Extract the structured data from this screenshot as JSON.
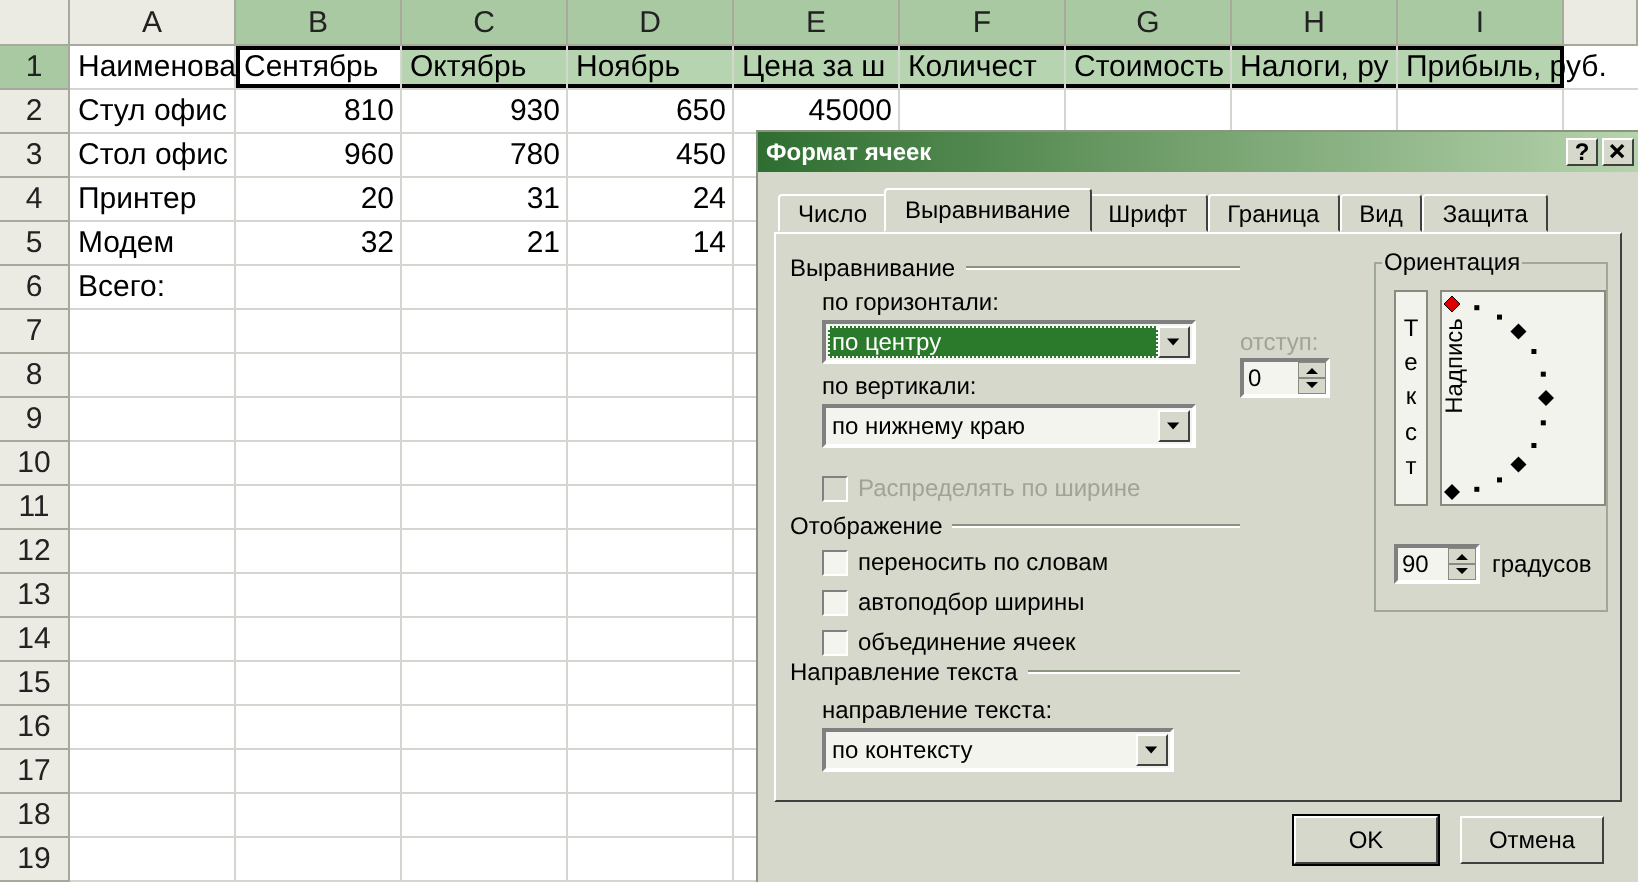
{
  "sheet": {
    "columns": [
      {
        "label": "A",
        "selected": false
      },
      {
        "label": "B",
        "selected": true
      },
      {
        "label": "C",
        "selected": true
      },
      {
        "label": "D",
        "selected": true
      },
      {
        "label": "E",
        "selected": true
      },
      {
        "label": "F",
        "selected": true
      },
      {
        "label": "G",
        "selected": true
      },
      {
        "label": "H",
        "selected": true
      },
      {
        "label": "I",
        "selected": true
      }
    ],
    "rows": [
      {
        "label": "1",
        "selected": true,
        "kind": "text",
        "cells": [
          "Наименова",
          "Сентябрь",
          "Октябрь",
          "Ноябрь",
          "Цена за ш",
          "Количест",
          "Стоимость",
          "Налоги, ру",
          "Прибыль, руб."
        ]
      },
      {
        "label": "2",
        "selected": false,
        "kind": "record",
        "cells": [
          "Стул офис",
          "810",
          "930",
          "650",
          "45000"
        ]
      },
      {
        "label": "3",
        "selected": false,
        "kind": "record",
        "cells": [
          "Стол офис",
          "960",
          "780",
          "450"
        ]
      },
      {
        "label": "4",
        "selected": false,
        "kind": "record",
        "cells": [
          "Принтер",
          "20",
          "31",
          "24"
        ]
      },
      {
        "label": "5",
        "selected": false,
        "kind": "record",
        "cells": [
          "Модем",
          "32",
          "21",
          "14"
        ]
      },
      {
        "label": "6",
        "selected": false,
        "kind": "text",
        "cells": [
          "Всего:"
        ]
      },
      {
        "label": "7",
        "selected": false
      },
      {
        "label": "8",
        "selected": false
      },
      {
        "label": "9",
        "selected": false
      },
      {
        "label": "10",
        "selected": false
      },
      {
        "label": "11",
        "selected": false
      },
      {
        "label": "12",
        "selected": false
      },
      {
        "label": "13",
        "selected": false
      },
      {
        "label": "14",
        "selected": false
      },
      {
        "label": "15",
        "selected": false
      },
      {
        "label": "16",
        "selected": false
      },
      {
        "label": "17",
        "selected": false
      },
      {
        "label": "18",
        "selected": false
      },
      {
        "label": "19",
        "selected": false
      }
    ]
  },
  "dialog": {
    "title": "Формат ячеек",
    "help_button": "?",
    "tabs": [
      {
        "label": "Число",
        "selected": false
      },
      {
        "label": "Выравнивание",
        "selected": true
      },
      {
        "label": "Шрифт",
        "selected": false
      },
      {
        "label": "Граница",
        "selected": false
      },
      {
        "label": "Вид",
        "selected": false
      },
      {
        "label": "Защита",
        "selected": false
      }
    ],
    "alignment": {
      "title": "Выравнивание",
      "horizontal": {
        "label": "по горизонтали:",
        "value": "по центру",
        "focused": true
      },
      "vertical": {
        "label": "по вертикали:",
        "value": "по нижнему краю",
        "focused": false
      },
      "indent": {
        "label": "отступ:",
        "value": "0",
        "disabled": true
      },
      "distribute": {
        "label": "Распределять по ширине",
        "checked": false,
        "disabled": true
      }
    },
    "display": {
      "title": "Отображение",
      "options": [
        {
          "label": "переносить по словам",
          "checked": false,
          "disabled": false
        },
        {
          "label": "автоподбор ширины",
          "checked": false,
          "disabled": false
        },
        {
          "label": "объединение ячеек",
          "checked": false,
          "disabled": false
        }
      ]
    },
    "direction": {
      "title": "Направление текста",
      "label": "направление текста:",
      "value": "по контексту",
      "focused": false
    },
    "orientation": {
      "title": "Ориентация",
      "vertical_text": "Текст",
      "rotated_text": "Надпись",
      "degrees": {
        "value": "90",
        "label": "градусов"
      }
    },
    "buttons": [
      {
        "label": "OK",
        "default": true
      },
      {
        "label": "Отмена",
        "default": false
      }
    ]
  }
}
